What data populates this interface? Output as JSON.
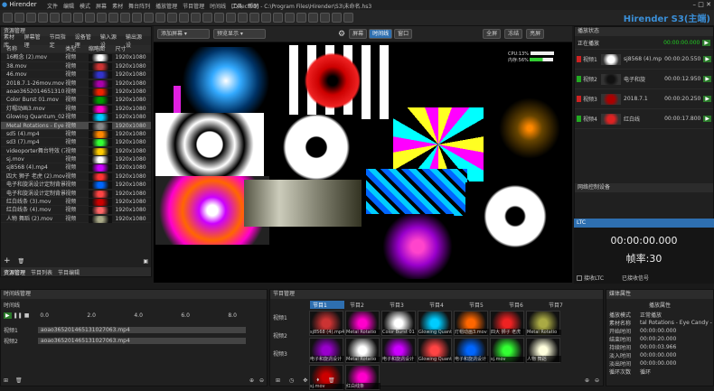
{
  "app": {
    "name": "Hirender",
    "brand": "Hirender S3(主端)",
    "path": "[Direct00] - C:\\Program Files\\Hirender\\S3\\未命名.hs3"
  },
  "menu": [
    "文件",
    "编辑",
    "模式",
    "屏幕",
    "素材",
    "舞台阵列",
    "播放管理",
    "节目管理",
    "时间线",
    "工具",
    "帮助"
  ],
  "media": {
    "title": "资源管理",
    "tabs": [
      "素材库",
      "屏幕管理",
      "节目指定",
      "设备管理",
      "输入源设",
      "输出源设"
    ],
    "headers": [
      "名称",
      "类型",
      "缩略图",
      "尺寸"
    ],
    "rows": [
      {
        "name": "16概念 (2).mov",
        "type": "视频",
        "size": "1920x1080"
      },
      {
        "name": "38.mov",
        "type": "视频",
        "size": "1920x1080"
      },
      {
        "name": "46.mov",
        "type": "视频",
        "size": "1920x1080"
      },
      {
        "name": "2018.7.1-26mov.mov",
        "type": "视频",
        "size": "1920x1080"
      },
      {
        "name": "aoao36520146513102706163.mp4",
        "type": "视频",
        "size": "1920x1080"
      },
      {
        "name": "Color Burst 01.mov",
        "type": "视频",
        "size": "1920x1080"
      },
      {
        "name": "灯帽动画3.mov",
        "type": "视频",
        "size": "1920x1080"
      },
      {
        "name": "Glowing Quantum_02.mov",
        "type": "视频",
        "size": "1920x1080"
      },
      {
        "name": "Metal Rotations - Eye Cand...",
        "type": "视频",
        "size": "1920x1080",
        "sel": true
      },
      {
        "name": "sd5 (4).mp4",
        "type": "视频",
        "size": "1920x1080"
      },
      {
        "name": "sd3 (7).mp4",
        "type": "视频",
        "size": "1920x1080"
      },
      {
        "name": "videoporter舞台特效 (7).mov",
        "type": "视频",
        "size": "1920x1080"
      },
      {
        "name": "sj.mov",
        "type": "视频",
        "size": "1920x1080"
      },
      {
        "name": "sj8568 (4).mp4",
        "type": "视频",
        "size": "1920x1080"
      },
      {
        "name": "四大 狮子 老虎 (2).mov",
        "type": "视频",
        "size": "1920x1080"
      },
      {
        "name": "电子和旋涡设计定制背景v01.mp4",
        "type": "视频",
        "size": "1920x1080"
      },
      {
        "name": "电子和旋涡设计定制背景v02.mov",
        "type": "视频",
        "size": "1920x1080"
      },
      {
        "name": "红白线条 (3).mov",
        "type": "视频",
        "size": "1920x1080"
      },
      {
        "name": "红白线条 (4).mov",
        "type": "视频",
        "size": "1920x1080"
      },
      {
        "name": "人物 舞蹈 (2).mov",
        "type": "视频",
        "size": "1920x1080"
      }
    ],
    "bottomtabs": [
      "资源管理",
      "节目列表",
      "节目编辑"
    ]
  },
  "preview": {
    "screen_select": "添加屏幕",
    "mode_select": "预览显示",
    "modes": [
      "屏幕",
      "时间线",
      "窗口"
    ],
    "right_buttons": [
      "全屏",
      "冻结",
      "亮屏"
    ],
    "cpu": "CPU:13%",
    "mem": "内存:56%"
  },
  "right": {
    "title": "播放状态",
    "subtitle": "正在播放",
    "time": "00:00:00.000",
    "items": [
      {
        "name": "视频1",
        "file": "sj8568 (4).mp4",
        "time": "00:00:20.550"
      },
      {
        "name": "视频2",
        "file": "电子和旋",
        "time": "00:00:12.950"
      },
      {
        "name": "视频3",
        "file": "2018.7.1",
        "time": "00:00:20.250"
      },
      {
        "name": "视频4",
        "file": "红白线",
        "time": "00:00:17.800"
      }
    ],
    "devtitle": "网络控制设备"
  },
  "ltc": {
    "title": "LTC",
    "time": "00:00:00.000",
    "fps": "帧率:30",
    "check": "接收LTC",
    "status": "已接收信号"
  },
  "timeline": {
    "title": "时间线管理",
    "sub": "时间线",
    "ticks": [
      "0.0",
      "2.0",
      "4.0",
      "6.0",
      "8.0"
    ],
    "track1": "视频1",
    "track2": "视频2",
    "clip1": "aoao365201465131027063.mp4",
    "clip2": "aoao365201465131027063.mp4"
  },
  "cue": {
    "title": "节目管理",
    "tabs": [
      "节目1",
      "节目2",
      "节目3",
      "节目4",
      "节目5",
      "节目6",
      "节目7"
    ],
    "rows": [
      "视频1",
      "视频2",
      "视频3"
    ],
    "labels": [
      "sj8568 (4).mp4",
      "Metal Rotatio",
      "Color Burst 01",
      "Glowing Quant",
      "灯帽动画3.mov",
      "四大 狮子 老虎",
      "Metal Rotatio",
      "电子和旋涡设计",
      "Metal Rotatio",
      "电子和旋涡设计",
      "Glowing Quant",
      "电子和旋涡设计",
      "sj.mov",
      "人物 舞蹈",
      "sj.mov",
      "红白线条"
    ]
  },
  "props": {
    "title": "媒体属性",
    "sub": "播放属性",
    "fields": [
      {
        "k": "播放模式",
        "v": "正常播放"
      },
      {
        "k": "素材名称",
        "v": "tal Rotations - Eye Candy -"
      },
      {
        "k": "开始时间",
        "v": "00:00:00.000"
      },
      {
        "k": "结束时间",
        "v": "00:00:20.000"
      },
      {
        "k": "持续时间",
        "v": "00:00:03.966"
      },
      {
        "k": "淡入时间",
        "v": "00:00:00.000"
      },
      {
        "k": "淡出时间",
        "v": "00:00:00.000"
      },
      {
        "k": "循环次数",
        "v": "循环"
      }
    ]
  },
  "colors": {
    "accent": "#3a8fd8",
    "play": "#2a9a2a",
    "record": "#c02020"
  }
}
